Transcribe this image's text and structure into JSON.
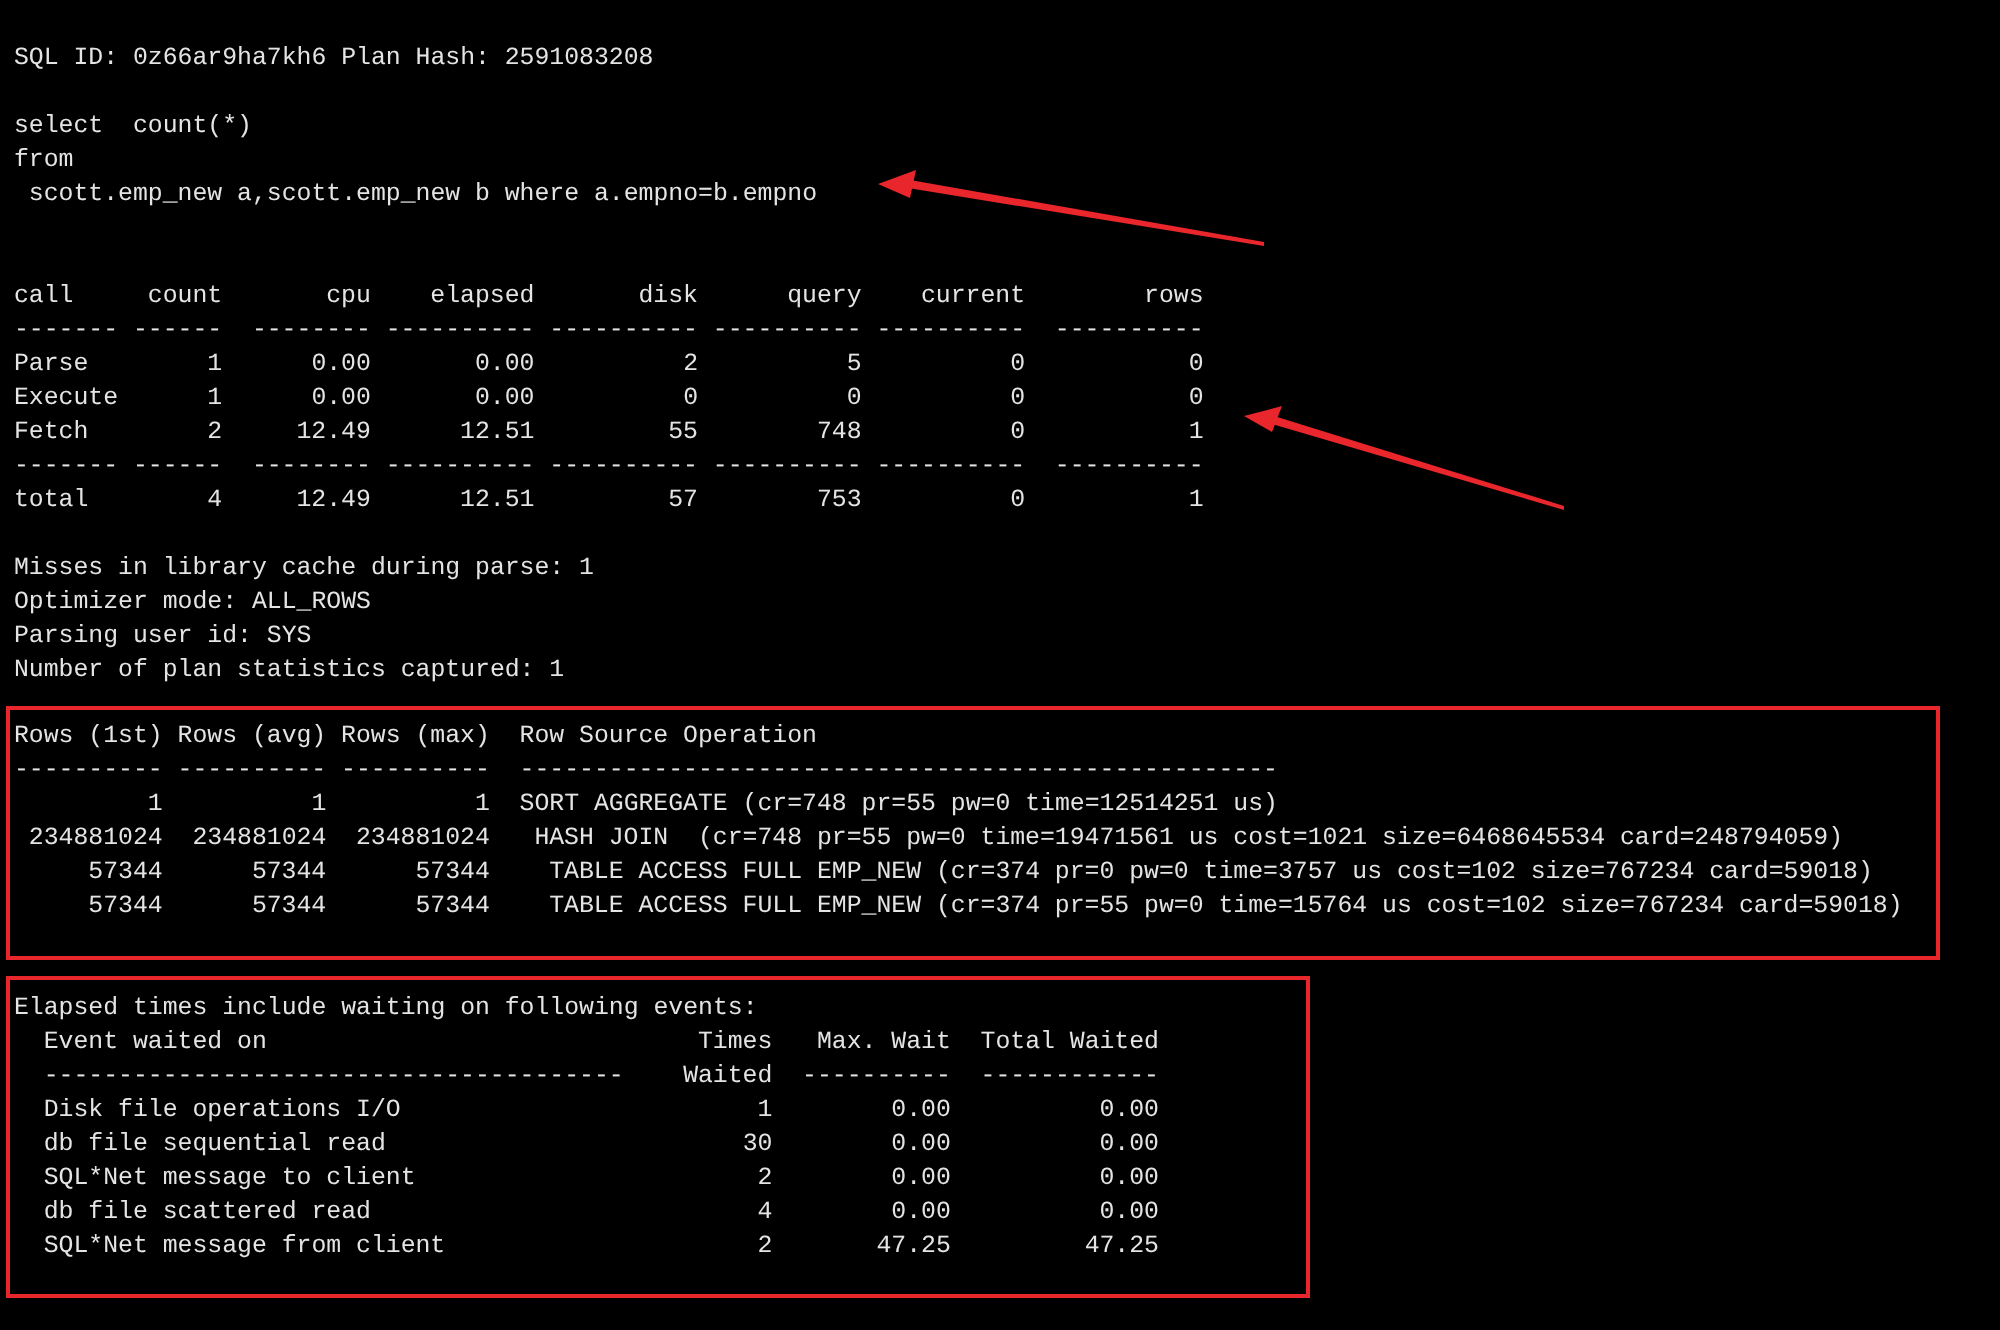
{
  "sql_header": "SQL ID: 0z66ar9ha7kh6 Plan Hash: 2591083208",
  "statement": [
    "select  count(*)",
    "from",
    " scott.emp_new a,scott.emp_new b where a.empno=b.empno"
  ],
  "call_table": {
    "columns": [
      "call",
      "count",
      "cpu",
      "elapsed",
      "disk",
      "query",
      "current",
      "rows"
    ],
    "header_rules": [
      "-------",
      "------",
      "--------",
      "----------",
      "----------",
      "----------",
      "----------",
      "----------"
    ],
    "rows": [
      [
        "Parse",
        "1",
        "0.00",
        "0.00",
        "2",
        "5",
        "0",
        "0"
      ],
      [
        "Execute",
        "1",
        "0.00",
        "0.00",
        "0",
        "0",
        "0",
        "0"
      ],
      [
        "Fetch",
        "2",
        "12.49",
        "12.51",
        "55",
        "748",
        "0",
        "1"
      ]
    ],
    "total_rules": [
      "-------",
      "------",
      "--------",
      "----------",
      "----------",
      "----------",
      "----------",
      "----------"
    ],
    "total": [
      "total",
      "4",
      "12.49",
      "12.51",
      "57",
      "753",
      "0",
      "1"
    ]
  },
  "parse_info": [
    "Misses in library cache during parse: 1",
    "Optimizer mode: ALL_ROWS",
    "Parsing user id: SYS",
    "Number of plan statistics captured: 1"
  ],
  "plan_table": {
    "columns": [
      "Rows (1st)",
      "Rows (avg)",
      "Rows (max)",
      "Row Source Operation"
    ],
    "rules": [
      "----------",
      "----------",
      "----------",
      "---------------------------------------------------"
    ],
    "rows": [
      {
        "rows_1st": "1",
        "rows_avg": "1",
        "rows_max": "1",
        "operation": "SORT AGGREGATE (cr=748 pr=55 pw=0 time=12514251 us)",
        "children": [
          {
            "rows_1st": "234881024",
            "rows_avg": "234881024",
            "rows_max": "234881024",
            "operation": "HASH JOIN  (cr=748 pr=55 pw=0 time=19471561 us cost=1021 size=6468645534 card=248794059)",
            "children": [
              {
                "rows_1st": "57344",
                "rows_avg": "57344",
                "rows_max": "57344",
                "operation": "TABLE ACCESS FULL EMP_NEW (cr=374 pr=0 pw=0 time=3757 us cost=102 size=767234 card=59018)"
              },
              {
                "rows_1st": "57344",
                "rows_avg": "57344",
                "rows_max": "57344",
                "operation": "TABLE ACCESS FULL EMP_NEW (cr=374 pr=55 pw=0 time=15764 us cost=102 size=767234 card=59018)"
              }
            ]
          }
        ]
      }
    ]
  },
  "wait_events": {
    "intro": "Elapsed times include waiting on following events:",
    "columns": [
      {
        "label": "Event waited on",
        "rule": "---------------------------------------"
      },
      {
        "label": "Times Waited"
      },
      {
        "label": "Max. Wait",
        "rule": "----------"
      },
      {
        "label": "Total Waited",
        "rule": "------------"
      }
    ],
    "rows": [
      [
        "Disk file operations I/O",
        "1",
        "0.00",
        "0.00"
      ],
      [
        "db file sequential read",
        "30",
        "0.00",
        "0.00"
      ],
      [
        "SQL*Net message to client",
        "2",
        "0.00",
        "0.00"
      ],
      [
        "db file scattered read",
        "4",
        "0.00",
        "0.00"
      ],
      [
        "SQL*Net message from client",
        "2",
        "47.25",
        "47.25"
      ]
    ]
  }
}
